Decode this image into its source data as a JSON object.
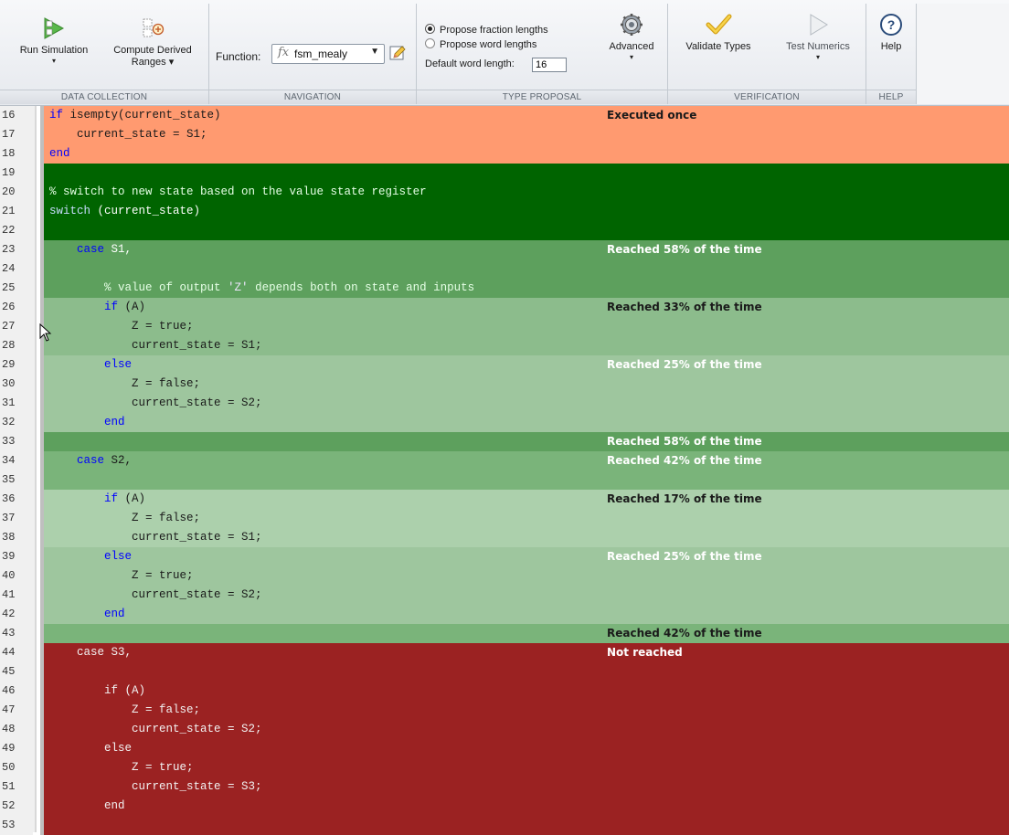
{
  "toolstrip": {
    "run_simulation": "Run Simulation",
    "compute_derived": "Compute Derived",
    "compute_derived_2": "Ranges ▾",
    "function_label": "Function:",
    "function_value": "fsm_mealy",
    "fraction_label": "Propose fraction lengths",
    "word_label": "Propose word lengths",
    "default_word_label": "Default word length:",
    "default_word_value": "16",
    "advanced_label": "Advanced",
    "validate_label": "Validate Types",
    "test_numerics_label": "Test Numerics",
    "help_label": "Help",
    "sections": {
      "data_collection": "DATA COLLECTION",
      "navigation": "NAVIGATION",
      "type_proposal": "TYPE PROPOSAL",
      "verification": "VERIFICATION",
      "help": "HELP"
    }
  },
  "colors": {
    "executed_once": "#ff9a70",
    "green_dark": "#006400",
    "green_58": "#5da05d",
    "green_33": "#8cbc8c",
    "green_25": "#9ec69e",
    "green_42": "#7ab47a",
    "green_17": "#acd0ac",
    "not_reached": "#9b2222"
  },
  "editor": {
    "lines": [
      {
        "n": "16",
        "bg": "#ff9a70",
        "tokens": [
          [
            "kw",
            "if"
          ],
          [
            "",
            "isempty(current_state)"
          ]
        ],
        "pre": ""
      },
      {
        "n": "17",
        "bg": "#ff9a70",
        "tokens": [
          [
            "",
            "current_state = S1;"
          ]
        ],
        "pre": "    "
      },
      {
        "n": "18",
        "bg": "#ff9a70",
        "tokens": [
          [
            "kw",
            "end"
          ]
        ],
        "pre": ""
      },
      {
        "n": "19",
        "bg": "#006400",
        "tokens": [],
        "pre": ""
      },
      {
        "n": "20",
        "bg": "#006400",
        "tokens": [
          [
            "cm",
            "% switch to new state based on the value state register"
          ]
        ],
        "pre": ""
      },
      {
        "n": "21",
        "bg": "#006400",
        "tokens": [
          [
            "kw",
            "switch"
          ],
          [
            "",
            "(current_state)"
          ]
        ],
        "pre": ""
      },
      {
        "n": "22",
        "bg": "#006400",
        "tokens": [],
        "pre": ""
      },
      {
        "n": "23",
        "bg": "#5da05d",
        "tokens": [
          [
            "kw",
            "case"
          ],
          [
            "",
            "S1,"
          ]
        ],
        "pre": "    "
      },
      {
        "n": "24",
        "bg": "#5da05d",
        "tokens": [],
        "pre": ""
      },
      {
        "n": "25",
        "bg": "#5da05d",
        "tokens": [
          [
            "cm",
            "% value of output "
          ],
          [
            "st",
            "'Z'"
          ],
          [
            "cm",
            " depends both on state and inputs"
          ]
        ],
        "pre": "        "
      },
      {
        "n": "26",
        "bg": "#8cbc8c",
        "tokens": [
          [
            "kw",
            "if"
          ],
          [
            "",
            "(A)"
          ]
        ],
        "pre": "        "
      },
      {
        "n": "27",
        "bg": "#8cbc8c",
        "tokens": [
          [
            "",
            "Z = true;"
          ]
        ],
        "pre": "            "
      },
      {
        "n": "28",
        "bg": "#8cbc8c",
        "tokens": [
          [
            "",
            "current_state = S1;"
          ]
        ],
        "pre": "            "
      },
      {
        "n": "29",
        "bg": "#9ec69e",
        "tokens": [
          [
            "kw",
            "else"
          ]
        ],
        "pre": "        "
      },
      {
        "n": "30",
        "bg": "#9ec69e",
        "tokens": [
          [
            "",
            "Z = false;"
          ]
        ],
        "pre": "            "
      },
      {
        "n": "31",
        "bg": "#9ec69e",
        "tokens": [
          [
            "",
            "current_state = S2;"
          ]
        ],
        "pre": "            "
      },
      {
        "n": "32",
        "bg": "#9ec69e",
        "tokens": [
          [
            "kw",
            "end"
          ]
        ],
        "pre": "        "
      },
      {
        "n": "33",
        "bg": "#5da05d",
        "tokens": [],
        "pre": ""
      },
      {
        "n": "34",
        "bg": "#7ab47a",
        "tokens": [
          [
            "kw",
            "case"
          ],
          [
            "",
            "S2,"
          ]
        ],
        "pre": "    "
      },
      {
        "n": "35",
        "bg": "#7ab47a",
        "tokens": [],
        "pre": ""
      },
      {
        "n": "36",
        "bg": "#acd0ac",
        "tokens": [
          [
            "kw",
            "if"
          ],
          [
            "",
            "(A)"
          ]
        ],
        "pre": "        "
      },
      {
        "n": "37",
        "bg": "#acd0ac",
        "tokens": [
          [
            "",
            "Z = false;"
          ]
        ],
        "pre": "            "
      },
      {
        "n": "38",
        "bg": "#acd0ac",
        "tokens": [
          [
            "",
            "current_state = S1;"
          ]
        ],
        "pre": "            "
      },
      {
        "n": "39",
        "bg": "#9ec69e",
        "tokens": [
          [
            "kw",
            "else"
          ]
        ],
        "pre": "        "
      },
      {
        "n": "40",
        "bg": "#9ec69e",
        "tokens": [
          [
            "",
            "Z = true;"
          ]
        ],
        "pre": "            "
      },
      {
        "n": "41",
        "bg": "#9ec69e",
        "tokens": [
          [
            "",
            "current_state = S2;"
          ]
        ],
        "pre": "            "
      },
      {
        "n": "42",
        "bg": "#9ec69e",
        "tokens": [
          [
            "kw",
            "end"
          ]
        ],
        "pre": "        "
      },
      {
        "n": "43",
        "bg": "#7ab47a",
        "tokens": [],
        "pre": ""
      },
      {
        "n": "44",
        "bg": "#9b2222",
        "tokens": [
          [
            "",
            "case S3,"
          ]
        ],
        "pre": "    ",
        "light": true
      },
      {
        "n": "45",
        "bg": "#9b2222",
        "tokens": [],
        "pre": ""
      },
      {
        "n": "46",
        "bg": "#9b2222",
        "tokens": [
          [
            "",
            "if (A)"
          ]
        ],
        "pre": "        ",
        "light": true
      },
      {
        "n": "47",
        "bg": "#9b2222",
        "tokens": [
          [
            "",
            "Z = false;"
          ]
        ],
        "pre": "            ",
        "light": true
      },
      {
        "n": "48",
        "bg": "#9b2222",
        "tokens": [
          [
            "",
            "current_state = S2;"
          ]
        ],
        "pre": "            ",
        "light": true
      },
      {
        "n": "49",
        "bg": "#9b2222",
        "tokens": [
          [
            "",
            "else"
          ]
        ],
        "pre": "        ",
        "light": true
      },
      {
        "n": "50",
        "bg": "#9b2222",
        "tokens": [
          [
            "",
            "Z = true;"
          ]
        ],
        "pre": "            ",
        "light": true
      },
      {
        "n": "51",
        "bg": "#9b2222",
        "tokens": [
          [
            "",
            "current_state = S3;"
          ]
        ],
        "pre": "            ",
        "light": true
      },
      {
        "n": "52",
        "bg": "#9b2222",
        "tokens": [
          [
            "",
            "end"
          ]
        ],
        "pre": "        ",
        "light": true
      },
      {
        "n": "53",
        "bg": "#9b2222",
        "tokens": [],
        "pre": ""
      }
    ],
    "annotations": [
      {
        "line": "16",
        "text": "Executed once",
        "color": "#1a1a1a"
      },
      {
        "line": "23",
        "text": "Reached 58% of the time",
        "color": "#ffffff"
      },
      {
        "line": "26",
        "text": "Reached 33% of the time",
        "color": "#1a1a1a"
      },
      {
        "line": "29",
        "text": "Reached 25% of the time",
        "color": "#ffffff"
      },
      {
        "line": "33",
        "text": "Reached 58% of the time",
        "color": "#ffffff"
      },
      {
        "line": "34",
        "text": "Reached 42% of the time",
        "color": "#ffffff"
      },
      {
        "line": "36",
        "text": "Reached 17% of the time",
        "color": "#1a1a1a"
      },
      {
        "line": "39",
        "text": "Reached 25% of the time",
        "color": "#ffffff"
      },
      {
        "line": "43",
        "text": "Reached 42% of the time",
        "color": "#1a1a1a"
      },
      {
        "line": "44",
        "text": "Not reached",
        "color": "#ffffff"
      }
    ]
  }
}
